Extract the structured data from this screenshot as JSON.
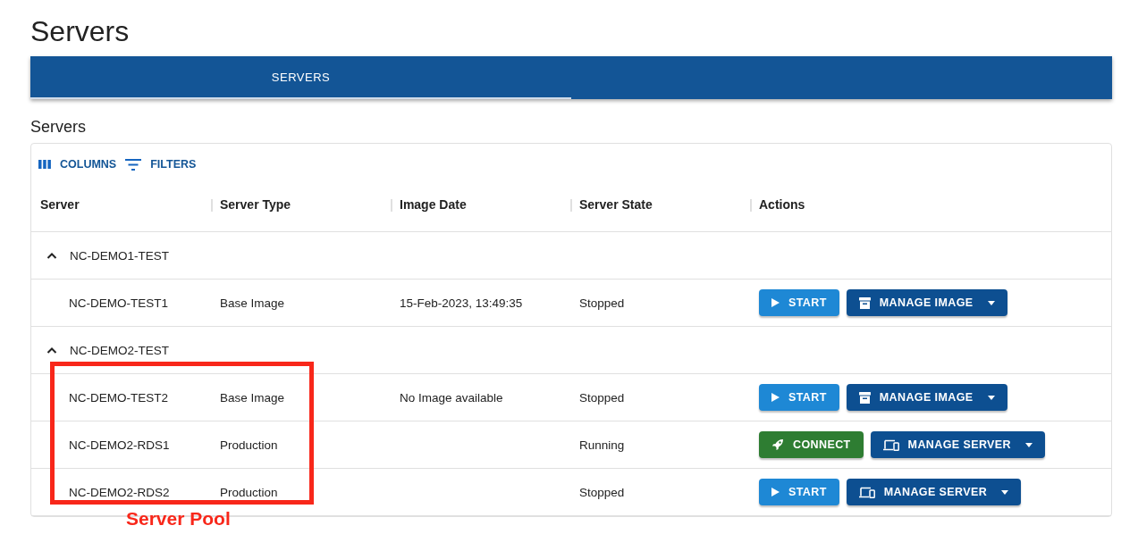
{
  "page_title": "Servers",
  "tabs": [
    {
      "label": "SERVERS",
      "selected": true
    }
  ],
  "section_title": "Servers",
  "toolbar": [
    {
      "kind": "columns",
      "label": "COLUMNS"
    },
    {
      "kind": "filters",
      "label": "FILTERS"
    }
  ],
  "columns": [
    "Server",
    "Server Type",
    "Image Date",
    "Server State",
    "Actions"
  ],
  "groups": [
    {
      "name": "NC-DEMO1-TEST",
      "expanded": true,
      "rows": [
        {
          "server": "NC-DEMO-TEST1",
          "type": "Base Image",
          "image_date": "15-Feb-2023, 13:49:35",
          "state": "Stopped",
          "actions": [
            {
              "kind": "start",
              "label": "START"
            },
            {
              "kind": "manage-image",
              "label": "MANAGE IMAGE"
            }
          ]
        }
      ]
    },
    {
      "name": "NC-DEMO2-TEST",
      "expanded": true,
      "rows": [
        {
          "server": "NC-DEMO-TEST2",
          "type": "Base Image",
          "image_date": "No Image available",
          "state": "Stopped",
          "actions": [
            {
              "kind": "start",
              "label": "START"
            },
            {
              "kind": "manage-image",
              "label": "MANAGE IMAGE"
            }
          ]
        },
        {
          "server": "NC-DEMO2-RDS1",
          "type": "Production",
          "state": "Running",
          "actions": [
            {
              "kind": "connect",
              "label": "CONNECT"
            },
            {
              "kind": "manage-server",
              "label": "MANAGE SERVER"
            }
          ]
        },
        {
          "server": "NC-DEMO2-RDS2",
          "type": "Production",
          "state": "Stopped",
          "actions": [
            {
              "kind": "start",
              "label": "START"
            },
            {
              "kind": "manage-server",
              "label": "MANAGE SERVER"
            }
          ]
        }
      ]
    }
  ],
  "annotation": {
    "label": "Server Pool"
  }
}
